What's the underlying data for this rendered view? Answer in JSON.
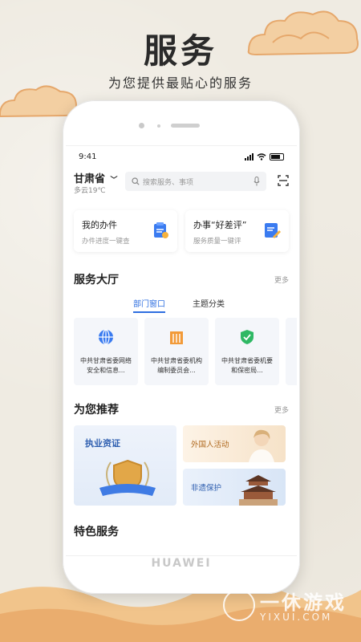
{
  "promo": {
    "headline": "服务",
    "subline": "为您提供最贴心的服务"
  },
  "device": {
    "brand": "HUAWEI"
  },
  "status_bar": {
    "time": "9:41"
  },
  "topbar": {
    "location": "甘肃省",
    "weather": "多云19℃",
    "search_placeholder": "搜索服务、事项"
  },
  "quick_cards": [
    {
      "title": "我的办件",
      "subtitle": "办件进度一键查",
      "icon": "clipboard-icon"
    },
    {
      "title": "办事“好差评”",
      "subtitle": "服务质量一键评",
      "icon": "edit-note-icon"
    }
  ],
  "service_hall": {
    "title": "服务大厅",
    "more": "更多",
    "tabs": [
      {
        "label": "部门窗口",
        "active": true
      },
      {
        "label": "主题分类",
        "active": false
      }
    ],
    "departments": [
      {
        "name": "中共甘肃省委网络安全和信息...",
        "icon": "network-icon"
      },
      {
        "name": "中共甘肃省委机构编制委员会...",
        "icon": "building-icon"
      },
      {
        "name": "中共甘肃省委机要和保密局...",
        "icon": "shield-icon"
      }
    ]
  },
  "recommend": {
    "title": "为您推荐",
    "more": "更多",
    "items": [
      {
        "label": "执业资证"
      },
      {
        "label": "外国人活动"
      },
      {
        "label": "非遗保护"
      }
    ]
  },
  "featured": {
    "title": "特色服务"
  },
  "watermark": {
    "text": "一休游戏",
    "sub": "YIXUI.COM"
  },
  "colors": {
    "accent": "#2f6fe0",
    "background": "#efebe2",
    "cloud": "#f0c79a"
  }
}
